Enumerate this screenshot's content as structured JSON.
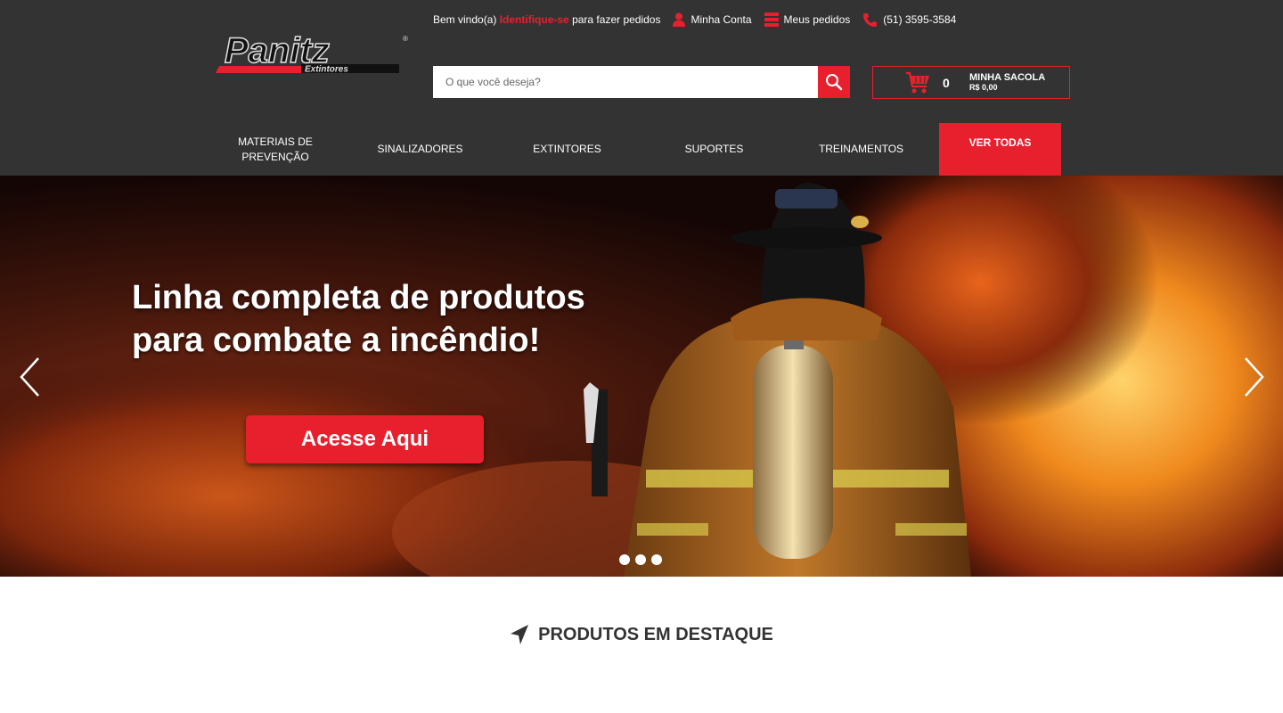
{
  "brand": {
    "name": "Panitz",
    "sub": "Extintores",
    "accent": "#e8202e",
    "header_bg": "#333333"
  },
  "topbar": {
    "welcome_prefix": "Bem vindo(a)",
    "identify": "Identifique-se",
    "welcome_suffix": "para fazer pedidos",
    "account": "Minha Conta",
    "orders": "Meus pedidos",
    "phone": "(51) 3595-3584"
  },
  "search": {
    "placeholder": "O que você deseja?",
    "icon": "search-icon"
  },
  "cart": {
    "count": "0",
    "label": "MINHA SACOLA",
    "total": "R$ 0,00",
    "icon": "cart-icon"
  },
  "nav": {
    "items": [
      "MATERIAIS DE PREVENÇÃO",
      "SINALIZADORES",
      "EXTINTORES",
      "SUPORTES",
      "TREINAMENTOS"
    ],
    "all": "VER TODAS"
  },
  "hero": {
    "line1": "Linha completa de produtos",
    "line2": "para combate a incêndio!",
    "cta": "Acesse Aqui",
    "slides": 3
  },
  "featured": {
    "title": "PRODUTOS EM DESTAQUE",
    "icon": "location-arrow-icon"
  }
}
